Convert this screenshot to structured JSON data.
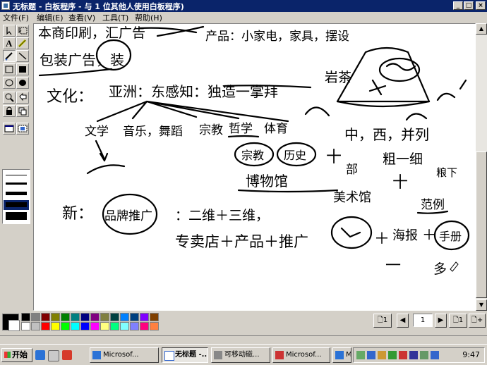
{
  "window": {
    "title": "无标题 - 白板程序 - 与 1 位其他人使用白板程序)",
    "controls": {
      "minimize": "_",
      "maximize": "□",
      "close": "×"
    }
  },
  "menu": {
    "items": [
      "文件(F)",
      "编辑(E)",
      "查看(V)",
      "工具(T)",
      "帮助(H)"
    ]
  },
  "tools": [
    {
      "icon": "select-area-icon"
    },
    {
      "icon": "select-object-icon"
    },
    {
      "icon": "text-icon"
    },
    {
      "icon": "highlighter-icon"
    },
    {
      "icon": "pen-icon"
    },
    {
      "icon": "line-icon"
    },
    {
      "icon": "rectangle-outline-icon"
    },
    {
      "icon": "rectangle-filled-icon"
    },
    {
      "icon": "ellipse-outline-icon"
    },
    {
      "icon": "ellipse-filled-icon"
    },
    {
      "icon": "zoom-icon"
    },
    {
      "icon": "remote-pointer-icon"
    },
    {
      "icon": "lock-icon"
    },
    {
      "icon": "sync-icon"
    },
    {
      "icon": "select-window-icon"
    },
    {
      "icon": "select-area-capture-icon"
    }
  ],
  "whiteboard": {
    "text": {
      "t1": "本商印刷，汇广告",
      "t2": "产品：小家电，家具，摆设",
      "t3": "包装广告，装",
      "t4": "文化：",
      "t5": "亚洲：东感知：独造一掌拜",
      "t6": "岩茶",
      "t7": "文学",
      "t8": "音乐，舞蹈",
      "t9": "宗教",
      "t10": "哲学",
      "t11": "体育",
      "t12": "中，西，并列",
      "t13": "宗教",
      "t14": "历史",
      "t15": "十",
      "t16": "部",
      "t17": "粗一细",
      "t18": "博物馆",
      "t19": "美术馆",
      "t20": "十",
      "t21": "粮下",
      "t22": "新：",
      "t23": "品牌推广",
      "t24": "：二维＋三维，",
      "t25": "专卖店＋产品＋推广",
      "t26": "＋",
      "t27": "海报",
      "t28": "＋",
      "t29": "范例",
      "t30": "手册",
      "t31": "一",
      "t32": "多"
    }
  },
  "palette": {
    "current_foreground": "#000000",
    "current_background": "#ffffff",
    "colors_top": [
      "#000000",
      "#808080",
      "#800000",
      "#808000",
      "#008000",
      "#008080",
      "#000080",
      "#800080",
      "#808040",
      "#004040",
      "#0080ff",
      "#004080",
      "#8000ff",
      "#804000"
    ],
    "colors_bottom": [
      "#ffffff",
      "#c0c0c0",
      "#ff0000",
      "#ffff00",
      "#00ff00",
      "#00ffff",
      "#0000ff",
      "#ff00ff",
      "#ffff80",
      "#00ff80",
      "#80ffff",
      "#8080ff",
      "#ff0080",
      "#ff8040"
    ]
  },
  "pager": {
    "first_label": "1",
    "current_page": "1",
    "last_label": "1",
    "add_label": "+"
  },
  "taskbar": {
    "start_label": "开始",
    "tasks": [
      "Microsof...",
      "无标题 -...",
      "可移动磁...",
      "Microsof...",
      "Microsof..."
    ],
    "clock": "9:47"
  }
}
